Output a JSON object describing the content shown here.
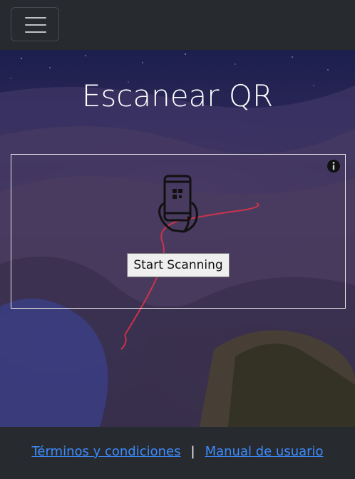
{
  "header": {
    "menu_icon": "hamburger-icon"
  },
  "main": {
    "title": "Escanear QR",
    "scanner": {
      "info_icon": "info-icon",
      "illustration_icon": "phone-qr-scan-icon",
      "start_button_label": "Start Scanning"
    }
  },
  "footer": {
    "links": [
      {
        "label": "Términos y condiciones"
      },
      {
        "label": "Manual de usuario"
      }
    ],
    "separator": "|"
  },
  "colors": {
    "topbar": "#272b30",
    "link": "#3d8bfd",
    "title": "#ffffff"
  }
}
